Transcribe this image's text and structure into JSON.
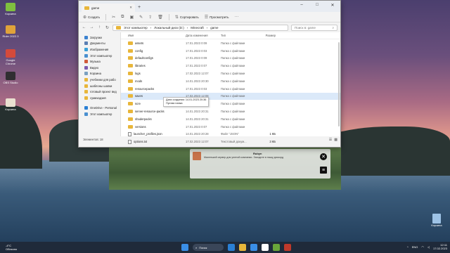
{
  "desktop": {
    "icons": [
      {
        "label": "Корзина",
        "color": "#7fbf3f"
      },
      {
        "label": "Rider 2022.3",
        "color": "#e0a33a"
      },
      {
        "label": "Google Chrome",
        "color": "#d44a3b"
      },
      {
        "label": "OBS Studio",
        "color": "#302e31"
      },
      {
        "label": "Корзина",
        "color": "#eae0d0"
      }
    ],
    "recycle_bin": "Корзина"
  },
  "explorer": {
    "tab_title": "game",
    "toolbar": {
      "create": "Создать",
      "sort": "Сортировать",
      "view": "Просмотреть"
    },
    "breadcrumb": [
      "Этот компьютер",
      "Локальный диск (D:)",
      "Minecraft",
      "game"
    ],
    "search_placeholder": "Поиск в: game",
    "sidebar": [
      {
        "label": "Загрузки",
        "color": "#3b82d0"
      },
      {
        "label": "Документы",
        "color": "#5b7fb3"
      },
      {
        "label": "Изображения",
        "color": "#3aa0d8"
      },
      {
        "label": "Этот компьютер",
        "color": "#4a90d0"
      },
      {
        "label": "Музыка",
        "color": "#d05a3a"
      },
      {
        "label": "Видео",
        "color": "#7b5bb0"
      },
      {
        "label": "Корзина",
        "color": "#7aa0c0"
      },
      {
        "label": "учебники для рабо",
        "color": "#e8b63a"
      },
      {
        "label": "шаблоны шапки",
        "color": "#e8b63a"
      },
      {
        "label": "готовый проект вед",
        "color": "#e8b63a"
      },
      {
        "label": "сумихадзия",
        "color": "#e8b63a"
      }
    ],
    "sidebar_bottom": [
      {
        "label": "OneDrive - Personal",
        "color": "#2a7fd4"
      },
      {
        "label": "Этот компьютер",
        "color": "#4a90d0"
      }
    ],
    "columns": {
      "name": "Имя",
      "date": "Дата изменения",
      "type": "Тип",
      "size": "Размер"
    },
    "rows": [
      {
        "name": "assets",
        "date": "17.01.2023 0:09",
        "type": "Папка с файлами",
        "size": "",
        "kind": "folder"
      },
      {
        "name": "config",
        "date": "17.01.2023 0:03",
        "type": "Папка с файлами",
        "size": "",
        "kind": "folder"
      },
      {
        "name": "defaultconfigs",
        "date": "17.01.2023 0:09",
        "type": "Папка с файлами",
        "size": "",
        "kind": "folder"
      },
      {
        "name": "libraries",
        "date": "17.01.2023 0:07",
        "type": "Папка с файлами",
        "size": "",
        "kind": "folder"
      },
      {
        "name": "logs",
        "date": "17.02.2023 12:07",
        "type": "Папка с файлами",
        "size": "",
        "kind": "folder"
      },
      {
        "name": "mods",
        "date": "14.01.2023 20:30",
        "type": "Папка с файлами",
        "size": "",
        "kind": "folder"
      },
      {
        "name": "resourcepacks",
        "date": "17.01.2023 0:03",
        "type": "Папка с файлами",
        "size": "",
        "kind": "folder"
      },
      {
        "name": "saves",
        "date": "17.02.2023 12:08",
        "type": "Папка с файлами",
        "size": "",
        "kind": "folder",
        "selected": true
      },
      {
        "name": "scre",
        "date": "14.01.2023 20:33",
        "type": "Папка с файлами",
        "size": "",
        "kind": "folder"
      },
      {
        "name": "server-resource-packs",
        "date": "14.01.2023 20:31",
        "type": "Папка с файлами",
        "size": "",
        "kind": "folder"
      },
      {
        "name": "shaderpacks",
        "date": "14.01.2023 20:31",
        "type": "Папка с файлами",
        "size": "",
        "kind": "folder"
      },
      {
        "name": "versions",
        "date": "17.01.2023 0:07",
        "type": "Папка с файлами",
        "size": "",
        "kind": "folder"
      },
      {
        "name": "launcher_profiles.json",
        "date": "14.01.2023 20:28",
        "type": "Файл \"JSON\"",
        "size": "1 КБ",
        "kind": "file"
      },
      {
        "name": "options.txt",
        "date": "17.02.2023 12:07",
        "type": "Текстовый докум...",
        "size": "3 КБ",
        "kind": "file"
      }
    ],
    "tooltip": {
      "line1": "Дата создания: 14.01.2023 20:36",
      "line2": "Пустая папка"
    },
    "status": "Элементов: 18"
  },
  "game_overlay": {
    "name": "Rubyn",
    "description": "Маленький сервер для уютной компании. Заходите в нашу дискорд"
  },
  "taskbar": {
    "weather_temp": "-4°C",
    "weather_desc": "Облачно",
    "search_label": "Поиск",
    "lang": "ENG",
    "time": "12:11",
    "date": "17.02.2023",
    "apps": [
      "#2a7fd4",
      "#e8b63a",
      "#3a8ee6",
      "#ffffff",
      "#6aa53a",
      "#c0392b"
    ]
  }
}
